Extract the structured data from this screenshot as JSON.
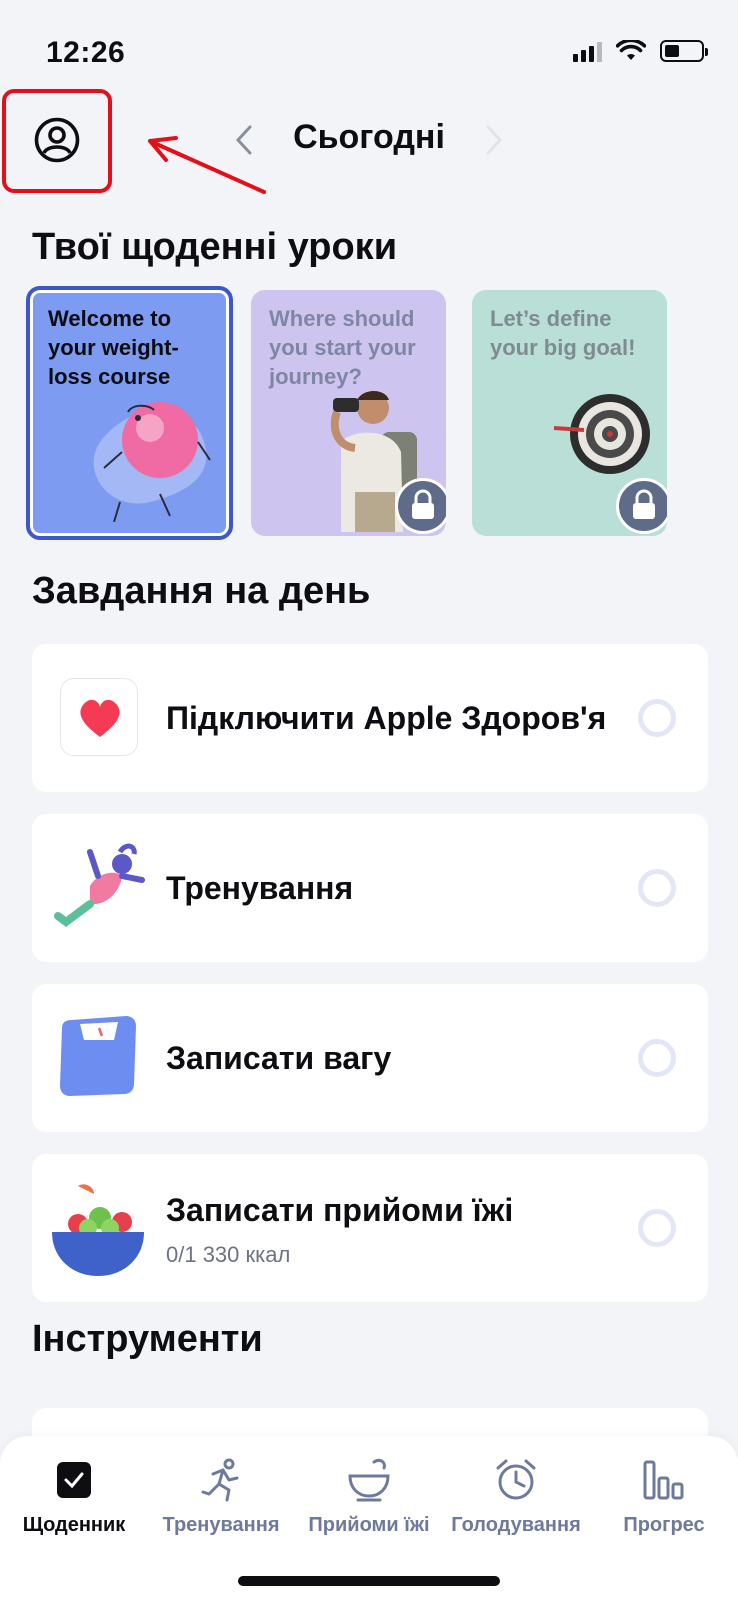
{
  "status": {
    "time": "12:26"
  },
  "header": {
    "title": "Сьогодні"
  },
  "lessons": {
    "title": "Твої щоденні уроки",
    "items": [
      {
        "text": "Welcome to your weight-loss course",
        "locked": false,
        "color": "#7e9bf2"
      },
      {
        "text": "Where should you start your journey?",
        "locked": true,
        "color": "#cdc5ef"
      },
      {
        "text": "Let’s define your big goal!",
        "locked": true,
        "color": "#b9dfd6"
      }
    ]
  },
  "tasks": {
    "title": "Завдання на день",
    "items": [
      {
        "label": "Підключити Apple Здоров'я",
        "icon": "heart-icon"
      },
      {
        "label": "Тренування",
        "icon": "workout-illustration"
      },
      {
        "label": "Записати вагу",
        "icon": "scale-icon"
      },
      {
        "label": "Записати прийоми їжі",
        "sub": "0/1 330 ккал",
        "icon": "salad-bowl-icon"
      }
    ]
  },
  "tools": {
    "title": "Інструменти"
  },
  "tabbar": {
    "items": [
      {
        "label": "Щоденник",
        "active": true
      },
      {
        "label": "Тренування",
        "active": false
      },
      {
        "label": "Прийоми їжі",
        "active": false
      },
      {
        "label": "Голодування",
        "active": false
      },
      {
        "label": "Прогрес",
        "active": false
      }
    ]
  },
  "colors": {
    "accent": "#3e57c9",
    "annotation": "#e3101a",
    "inactive_tab": "#6e7a9b"
  }
}
